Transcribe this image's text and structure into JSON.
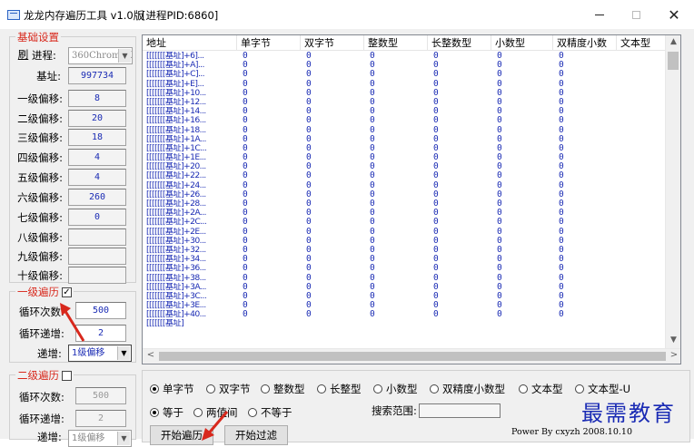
{
  "window": {
    "title": "龙龙内存遍历工具 v1.0版",
    "pid": "[进程PID:6860]",
    "minimize": "—",
    "close": "✕"
  },
  "basic": {
    "legend": "基础设置",
    "refresh_label": "刷",
    "process_label": "进程:",
    "process_value": "360ChromeX",
    "base_label": "基址:",
    "base_value": "997734",
    "offsets": [
      {
        "label": "一级偏移:",
        "value": "8"
      },
      {
        "label": "二级偏移:",
        "value": "20"
      },
      {
        "label": "三级偏移:",
        "value": "18"
      },
      {
        "label": "四级偏移:",
        "value": "4"
      },
      {
        "label": "五级偏移:",
        "value": "4"
      },
      {
        "label": "六级偏移:",
        "value": "260"
      },
      {
        "label": "七级偏移:",
        "value": "0"
      },
      {
        "label": "八级偏移:",
        "value": ""
      },
      {
        "label": "九级偏移:",
        "value": ""
      },
      {
        "label": "十级偏移:",
        "value": ""
      }
    ]
  },
  "level1": {
    "legend": "一级遍历",
    "checked": "✓",
    "loop_count_label": "循环次数:",
    "loop_count_value": "500",
    "loop_inc_label": "循环递增:",
    "loop_inc_value": "2",
    "inc_label": "递增:",
    "inc_value": "1级偏移"
  },
  "level2": {
    "legend": "二级遍历",
    "loop_count_label": "循环次数:",
    "loop_count_value": "500",
    "loop_inc_label": "循环递增:",
    "loop_inc_value": "2",
    "inc_label": "递增:",
    "inc_value": "1级偏移"
  },
  "table": {
    "columns": [
      "地址",
      "单字节",
      "双字节",
      "整数型",
      "长整数型",
      "小数型",
      "双精度小数",
      "文本型"
    ],
    "rows": [
      {
        "addr": "[[[[[[[基址]+6]...",
        "v": [
          "0",
          "0",
          "0",
          "0",
          "0",
          "0"
        ]
      },
      {
        "addr": "[[[[[[[基址]+A]...",
        "v": [
          "0",
          "0",
          "0",
          "0",
          "0",
          "0"
        ]
      },
      {
        "addr": "[[[[[[[基址]+C]...",
        "v": [
          "0",
          "0",
          "0",
          "0",
          "0",
          "0"
        ]
      },
      {
        "addr": "[[[[[[[基址]+E]...",
        "v": [
          "0",
          "0",
          "0",
          "0",
          "0",
          "0"
        ]
      },
      {
        "addr": "[[[[[[[基址]+10...",
        "v": [
          "0",
          "0",
          "0",
          "0",
          "0",
          "0"
        ]
      },
      {
        "addr": "[[[[[[[基址]+12...",
        "v": [
          "0",
          "0",
          "0",
          "0",
          "0",
          "0"
        ]
      },
      {
        "addr": "[[[[[[[基址]+14...",
        "v": [
          "0",
          "0",
          "0",
          "0",
          "0",
          "0"
        ]
      },
      {
        "addr": "[[[[[[[基址]+16...",
        "v": [
          "0",
          "0",
          "0",
          "0",
          "0",
          "0"
        ]
      },
      {
        "addr": "[[[[[[[基址]+18...",
        "v": [
          "0",
          "0",
          "0",
          "0",
          "0",
          "0"
        ]
      },
      {
        "addr": "[[[[[[[基址]+1A...",
        "v": [
          "0",
          "0",
          "0",
          "0",
          "0",
          "0"
        ]
      },
      {
        "addr": "[[[[[[[基址]+1C...",
        "v": [
          "0",
          "0",
          "0",
          "0",
          "0",
          "0"
        ]
      },
      {
        "addr": "[[[[[[[基址]+1E...",
        "v": [
          "0",
          "0",
          "0",
          "0",
          "0",
          "0"
        ]
      },
      {
        "addr": "[[[[[[[基址]+20...",
        "v": [
          "0",
          "0",
          "0",
          "0",
          "0",
          "0"
        ]
      },
      {
        "addr": "[[[[[[[基址]+22...",
        "v": [
          "0",
          "0",
          "0",
          "0",
          "0",
          "0"
        ]
      },
      {
        "addr": "[[[[[[[基址]+24...",
        "v": [
          "0",
          "0",
          "0",
          "0",
          "0",
          "0"
        ]
      },
      {
        "addr": "[[[[[[[基址]+26...",
        "v": [
          "0",
          "0",
          "0",
          "0",
          "0",
          "0"
        ]
      },
      {
        "addr": "[[[[[[[基址]+28...",
        "v": [
          "0",
          "0",
          "0",
          "0",
          "0",
          "0"
        ]
      },
      {
        "addr": "[[[[[[[基址]+2A...",
        "v": [
          "0",
          "0",
          "0",
          "0",
          "0",
          "0"
        ]
      },
      {
        "addr": "[[[[[[[基址]+2C...",
        "v": [
          "0",
          "0",
          "0",
          "0",
          "0",
          "0"
        ]
      },
      {
        "addr": "[[[[[[[基址]+2E...",
        "v": [
          "0",
          "0",
          "0",
          "0",
          "0",
          "0"
        ]
      },
      {
        "addr": "[[[[[[[基址]+30...",
        "v": [
          "0",
          "0",
          "0",
          "0",
          "0",
          "0"
        ]
      },
      {
        "addr": "[[[[[[[基址]+32...",
        "v": [
          "0",
          "0",
          "0",
          "0",
          "0",
          "0"
        ]
      },
      {
        "addr": "[[[[[[[基址]+34...",
        "v": [
          "0",
          "0",
          "0",
          "0",
          "0",
          "0"
        ]
      },
      {
        "addr": "[[[[[[[基址]+36...",
        "v": [
          "0",
          "0",
          "0",
          "0",
          "0",
          "0"
        ]
      },
      {
        "addr": "[[[[[[[基址]+38...",
        "v": [
          "0",
          "0",
          "0",
          "0",
          "0",
          "0"
        ]
      },
      {
        "addr": "[[[[[[[基址]+3A...",
        "v": [
          "0",
          "0",
          "0",
          "0",
          "0",
          "0"
        ]
      },
      {
        "addr": "[[[[[[[基址]+3C...",
        "v": [
          "0",
          "0",
          "0",
          "0",
          "0",
          "0"
        ]
      },
      {
        "addr": "[[[[[[[基址]+3E...",
        "v": [
          "0",
          "0",
          "0",
          "0",
          "0",
          "0"
        ]
      },
      {
        "addr": "[[[[[[[基址]+40...",
        "v": [
          "0",
          "0",
          "0",
          "0",
          "0",
          "0"
        ]
      },
      {
        "addr": "[[[[[[[基址]",
        "v": [
          "",
          "",
          "",
          "",
          "",
          ""
        ]
      }
    ]
  },
  "types": {
    "options": [
      "单字节",
      "双字节",
      "整数型",
      "长整型",
      "小数型",
      "双精度小数型",
      "文本型",
      "文本型-U"
    ],
    "selected": "单字节"
  },
  "compare": {
    "options": [
      "等于",
      "两值间",
      "不等于"
    ],
    "selected": "等于",
    "search_range_label": "搜索范围:"
  },
  "buttons": {
    "start_traverse": "开始遍历",
    "start_filter": "开始过滤"
  },
  "footer": "Power By cxyzh 2008.10.10",
  "watermark": "最需教育"
}
